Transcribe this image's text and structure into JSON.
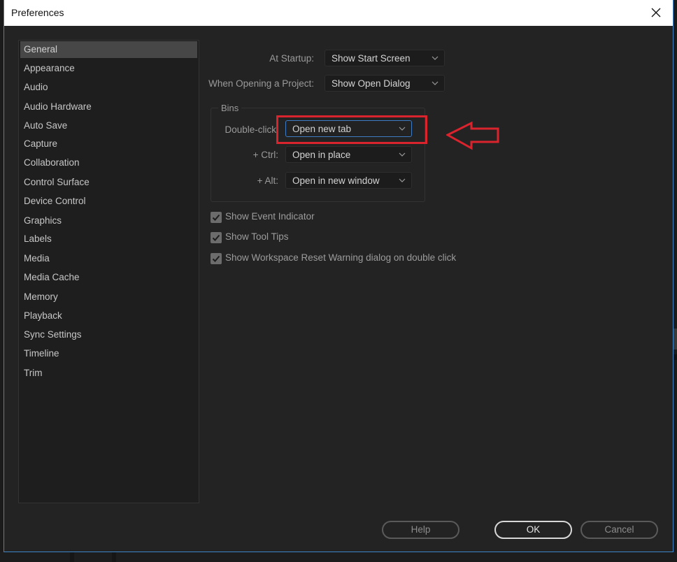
{
  "dialog": {
    "title": "Preferences",
    "close_icon": "close-icon"
  },
  "sidebar": {
    "selected": "General",
    "items": [
      {
        "label": "General"
      },
      {
        "label": "Appearance"
      },
      {
        "label": "Audio"
      },
      {
        "label": "Audio Hardware"
      },
      {
        "label": "Auto Save"
      },
      {
        "label": "Capture"
      },
      {
        "label": "Collaboration"
      },
      {
        "label": "Control Surface"
      },
      {
        "label": "Device Control"
      },
      {
        "label": "Graphics"
      },
      {
        "label": "Labels"
      },
      {
        "label": "Media"
      },
      {
        "label": "Media Cache"
      },
      {
        "label": "Memory"
      },
      {
        "label": "Playback"
      },
      {
        "label": "Sync Settings"
      },
      {
        "label": "Timeline"
      },
      {
        "label": "Trim"
      }
    ]
  },
  "general": {
    "at_startup": {
      "label": "At Startup:",
      "value": "Show Start Screen"
    },
    "when_opening": {
      "label": "When Opening a Project:",
      "value": "Show Open Dialog"
    },
    "bins": {
      "group_label": "Bins",
      "double_click": {
        "label": "Double-click",
        "value": "Open new tab"
      },
      "ctrl": {
        "label": "+ Ctrl:",
        "value": "Open in place"
      },
      "alt": {
        "label": "+ Alt:",
        "value": "Open in new window"
      }
    },
    "checkboxes": [
      {
        "label": "Show Event Indicator",
        "checked": true
      },
      {
        "label": "Show Tool Tips",
        "checked": true
      },
      {
        "label": "Show Workspace Reset Warning dialog on double click",
        "checked": true
      }
    ]
  },
  "buttons": {
    "help": "Help",
    "ok": "OK",
    "cancel": "Cancel"
  },
  "annotation": {
    "highlight_color": "#d9232d",
    "target": "Double-click dropdown",
    "arrow_direction": "left"
  },
  "colors": {
    "accent_focus": "#3c86c8",
    "dialog_bg": "#232323",
    "selected_item_bg": "#474747"
  }
}
